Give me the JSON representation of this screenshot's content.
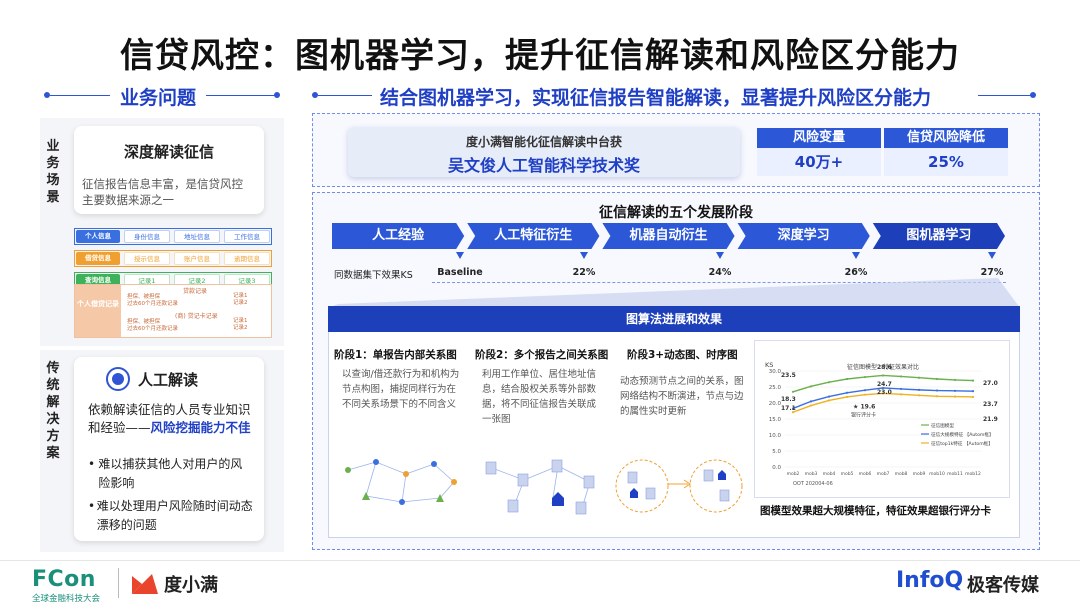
{
  "title": "信贷风控：图机器学习，提升征信解读和风险区分能力",
  "left_header": "业务问题",
  "right_header": "结合图机器学习，实现征信报告智能解读，显著提升风险区分能力",
  "scenario": {
    "label": "业务场景",
    "card_title": "深度解读征信",
    "card_body": "征信报告信息丰富，是信贷风控主要数据来源之一",
    "report_rows": [
      {
        "head": "个人信息",
        "cells": [
          "身份信息",
          "地址信息",
          "工作信息"
        ],
        "color": "#3a6fe0"
      },
      {
        "head": "借贷信息",
        "cells": [
          "授示信息",
          "账户信息",
          "逾期信息"
        ],
        "color": "#f0a030"
      },
      {
        "head": "查询信息",
        "cells": [
          "记录1",
          "记录2",
          "记录3"
        ],
        "color": "#3fb15a"
      }
    ],
    "borrow_block": {
      "head": "个人借贷记录",
      "sub1": "贷款记录",
      "sub2": "(商) 贷记卡记录",
      "lines": [
        "担保、被担保",
        "过去60个月还款记录",
        "担保、被担保",
        "过去60个月还款记录"
      ],
      "records": [
        "记录1",
        "记录2",
        "记录1",
        "记录2"
      ]
    }
  },
  "traditional": {
    "label": "传统解决方案",
    "card_title": "人工解读",
    "desc_plain": "依赖解读征信的人员专业知识和经验——",
    "desc_emph": "风险挖掘能力不佳",
    "bullets": [
      "难以捕获其他人对用户的风险影响",
      "难以处理用户风险随时间动态漂移的问题"
    ]
  },
  "award": {
    "line1": "度小满智能化征信解读中台获",
    "line2": "吴文俊人工智能科学技术奖"
  },
  "metrics": [
    {
      "label": "风险变量",
      "value": "40万+"
    },
    {
      "label": "信贷风险降低",
      "value": "25%"
    }
  ],
  "stages": {
    "title": "征信解读的五个发展阶段",
    "items": [
      "人工经验",
      "人工特征衍生",
      "机器自动衍生",
      "深度学习",
      "图机器学习"
    ],
    "axis_label": "同数据集下效果KS",
    "values": [
      "Baseline",
      "22%",
      "24%",
      "26%",
      "27%"
    ]
  },
  "algo": {
    "header": "图算法进展和效果",
    "phases": [
      {
        "title": "阶段1：单报告内部关系图",
        "body": "以查询/借还款行为和机构为节点构图，捕捉同样行为在不同关系场景下的不同含义"
      },
      {
        "title": "阶段2：多个报告之间关系图",
        "body": "利用工作单位、居住地址信息，结合股权关系等外部数据，将不同征信报告关联成一张图"
      },
      {
        "title": "阶段3+动态图、时序图",
        "body": "动态预测节点之间的关系，图网络结构不断演进，节点与边的属性实时更新"
      }
    ],
    "conclusion": "图模型效果超大规模特征，特征效果超银行评分卡"
  },
  "chart_data": {
    "type": "line",
    "title": "征信图模型、特征效果对比",
    "ylabel": "KS",
    "ylim": [
      0,
      30
    ],
    "yticks": [
      "0.0",
      "5.0",
      "10.0",
      "15.0",
      "20.0",
      "25.0",
      "30.0"
    ],
    "categories": [
      "mob2",
      "mob3",
      "mob4",
      "mob5",
      "mob6",
      "mob7",
      "mob8",
      "mob9",
      "mob10",
      "mob11",
      "mob12"
    ],
    "xnote": "OOT 202004-06",
    "series": [
      {
        "name": "征信图模型",
        "values": [
          23.5,
          25.2,
          26.5,
          27.5,
          28.1,
          28.6,
          28.3,
          27.9,
          27.5,
          27.2,
          27.0
        ],
        "color": "#6ab04c"
      },
      {
        "name": "征信大规模特征 【Autom框】",
        "values": [
          18.3,
          20.5,
          22.0,
          23.2,
          24.0,
          24.7,
          24.4,
          24.1,
          23.9,
          23.8,
          23.7
        ],
        "color": "#3a6fe0"
      },
      {
        "name": "征信top1k特征 【Autom框】",
        "values": [
          17.1,
          19.2,
          20.8,
          21.9,
          22.6,
          23.0,
          22.7,
          22.4,
          22.1,
          22.0,
          21.9
        ],
        "color": "#f0b020"
      }
    ],
    "annotations": {
      "start": [
        "23.5",
        "18.3",
        "17.1"
      ],
      "peak": [
        "28.6",
        "24.7",
        "23.0"
      ],
      "end": [
        "27.0",
        "23.7",
        "21.9"
      ],
      "bank": "19.6",
      "bank_label": "银行评分卡"
    }
  },
  "footer": {
    "fcon": "FCon",
    "fcon_sub": "全球金融科技大会",
    "du_brand": "度小满",
    "infoq": "InfoQ",
    "geek": "极客传媒"
  }
}
